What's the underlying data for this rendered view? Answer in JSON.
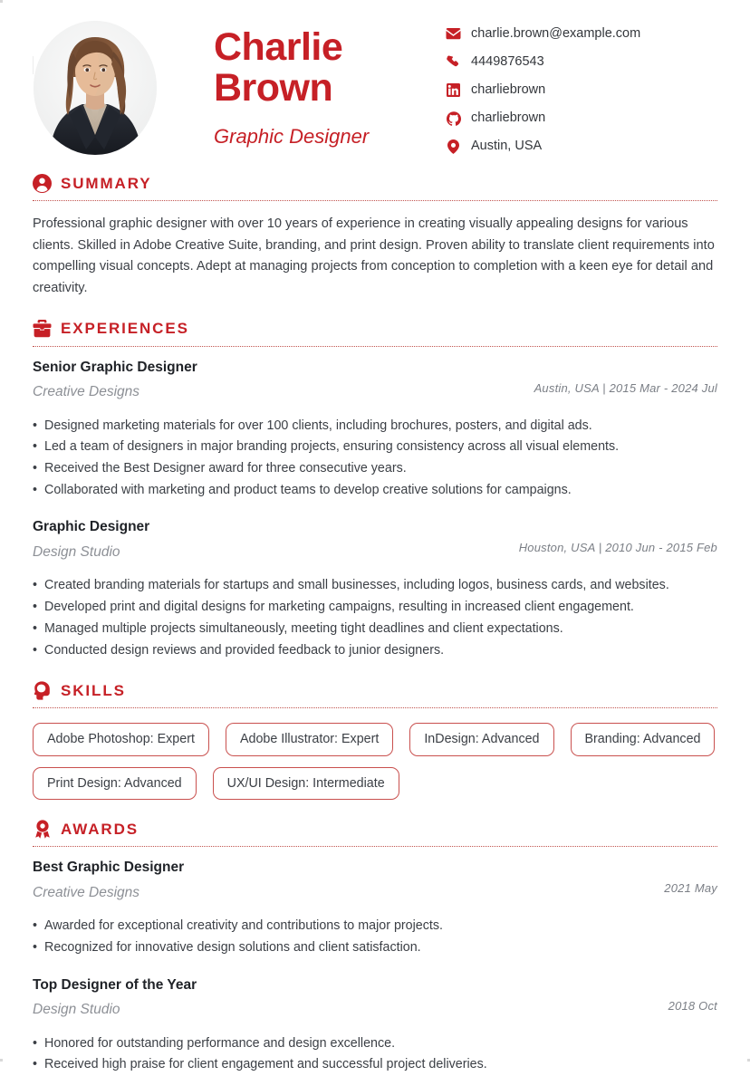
{
  "theme": {
    "accent": "#C62026",
    "rule_color": "#C1544F",
    "text": "#3b3f45",
    "muted": "#8d9096"
  },
  "header": {
    "name": "Charlie Brown",
    "job_title": "Graphic Designer",
    "photo_alt": "portrait-photo",
    "contacts": [
      {
        "icon": "envelope-icon",
        "value": "charlie.brown@example.com"
      },
      {
        "icon": "phone-icon",
        "value": "4449876543"
      },
      {
        "icon": "linkedin-icon",
        "value": "charliebrown"
      },
      {
        "icon": "github-icon",
        "value": "charliebrown"
      },
      {
        "icon": "location-pin-icon",
        "value": "Austin, USA"
      }
    ]
  },
  "summary": {
    "icon": "person-icon",
    "title": "SUMMARY",
    "text": "Professional graphic designer with over 10 years of experience in creating visually appealing designs for various clients. Skilled in Adobe Creative Suite, branding, and print design. Proven ability to translate client requirements into compelling visual concepts. Adept at managing projects from conception to completion with a keen eye for detail and creativity."
  },
  "experiences": {
    "icon": "briefcase-icon",
    "title": "EXPERIENCES",
    "entries": [
      {
        "role": "Senior Graphic Designer",
        "org": "Creative Designs",
        "meta": "Austin, USA  |  2015 Mar - 2024 Jul",
        "bullets": [
          "Designed marketing materials for over 100 clients, including brochures, posters, and digital ads.",
          "Led a team of designers in major branding projects, ensuring consistency across all visual elements.",
          "Received the Best Designer award for three consecutive years.",
          "Collaborated with marketing and product teams to develop creative solutions for campaigns."
        ]
      },
      {
        "role": "Graphic Designer",
        "org": "Design Studio",
        "meta": "Houston, USA  |  2010 Jun - 2015 Feb",
        "bullets": [
          "Created branding materials for startups and small businesses, including logos, business cards, and websites.",
          "Developed print and digital designs for marketing campaigns, resulting in increased client engagement.",
          "Managed multiple projects simultaneously, meeting tight deadlines and client expectations.",
          "Conducted design reviews and provided feedback to junior designers."
        ]
      }
    ]
  },
  "skills": {
    "icon": "head-brain-icon",
    "title": "SKILLS",
    "items": [
      "Adobe Photoshop: Expert",
      "Adobe Illustrator: Expert",
      "InDesign: Advanced",
      "Branding: Advanced",
      "Print Design: Advanced",
      "UX/UI Design: Intermediate"
    ]
  },
  "awards": {
    "icon": "medal-icon",
    "title": "AWARDS",
    "entries": [
      {
        "role": "Best Graphic Designer",
        "org": "Creative Designs",
        "meta": "2021 May",
        "bullets": [
          "Awarded for exceptional creativity and contributions to major projects.",
          "Recognized for innovative design solutions and client satisfaction."
        ]
      },
      {
        "role": "Top Designer of the Year",
        "org": "Design Studio",
        "meta": "2018 Oct",
        "bullets": [
          "Honored for outstanding performance and design excellence.",
          "Received high praise for client engagement and successful project deliveries."
        ]
      }
    ]
  }
}
